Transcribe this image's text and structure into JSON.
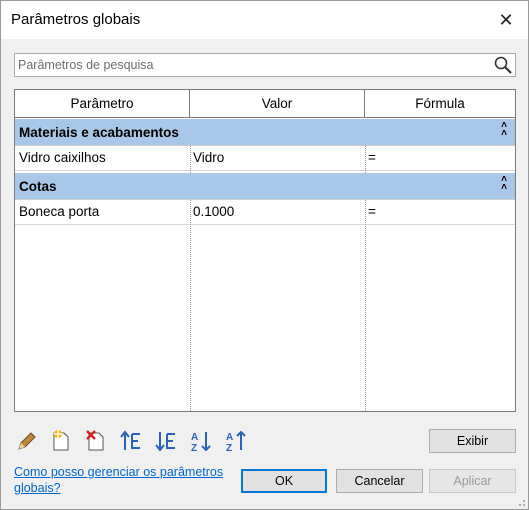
{
  "window": {
    "title": "Parâmetros globais",
    "close_icon": "close-icon"
  },
  "search": {
    "placeholder": "Parâmetros de pesquisa",
    "value": ""
  },
  "table": {
    "columns": [
      "Parâmetro",
      "Valor",
      "Fórmula"
    ],
    "groups": [
      {
        "label": "Materiais e acabamentos",
        "rows": [
          {
            "parameter": "Vidro caixilhos",
            "value": "Vidro",
            "formula": "="
          }
        ]
      },
      {
        "label": "Cotas",
        "rows": [
          {
            "parameter": "Boneca porta",
            "value": "0.1000",
            "formula": "="
          }
        ]
      }
    ]
  },
  "toolbar": {
    "icons": [
      "edit-pencil-icon",
      "new-parameter-icon",
      "delete-parameter-icon",
      "move-up-icon",
      "move-down-icon",
      "sort-ascending-icon",
      "sort-descending-icon"
    ]
  },
  "buttons": {
    "export": "Exibir",
    "ok": "OK",
    "cancel": "Cancelar",
    "apply": "Aplicar"
  },
  "help_link": "Como posso gerenciar os parâmetros globais?",
  "colors": {
    "group_header": "#a9c7e6",
    "default_button_border": "#0078d7",
    "link": "#0066cc"
  }
}
